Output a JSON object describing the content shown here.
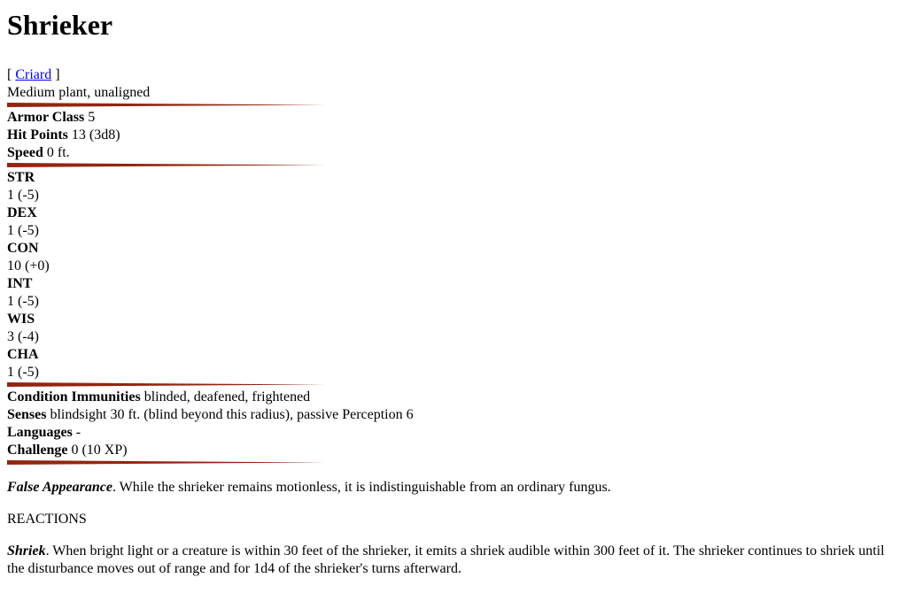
{
  "title": "Shrieker",
  "breadcrumb": {
    "open": "[ ",
    "link": "Criard",
    "close": " ]"
  },
  "type_line": "Medium plant, unaligned",
  "rule_color": "#922610",
  "basics": [
    {
      "label": "Armor Class",
      "value": " 5"
    },
    {
      "label": "Hit Points",
      "value": " 13 (3d8)"
    },
    {
      "label": "Speed",
      "value": " 0 ft."
    }
  ],
  "abilities": [
    {
      "name": "STR",
      "score": "1 (-5)"
    },
    {
      "name": "DEX",
      "score": "1 (-5)"
    },
    {
      "name": "CON",
      "score": "10 (+0)"
    },
    {
      "name": "INT",
      "score": "1 (-5)"
    },
    {
      "name": "WIS",
      "score": "3 (-4)"
    },
    {
      "name": "CHA",
      "score": "1 (-5)"
    }
  ],
  "properties": [
    {
      "label": "Condition Immunities",
      "value": " blinded, deafened, frightened"
    },
    {
      "label": "Senses",
      "value": " blindsight 30 ft. (blind beyond this radius), passive Perception 6"
    },
    {
      "label": "Languages",
      "value": " -"
    },
    {
      "label": "Challenge",
      "value": " 0 (10 XP)"
    }
  ],
  "traits": [
    {
      "name": "False Appearance",
      "text": ". While the shrieker remains motionless, it is indistinguishable from an ordinary fungus."
    }
  ],
  "reactions_heading": "REACTIONS",
  "reactions": [
    {
      "name": "Shriek",
      "text": ". When bright light or a creature is within 30 feet of the shrieker, it emits a shriek audible within 300 feet of it. The shrieker continues to shriek until the disturbance moves out of range and for 1d4 of the shrieker's turns afterward."
    }
  ]
}
